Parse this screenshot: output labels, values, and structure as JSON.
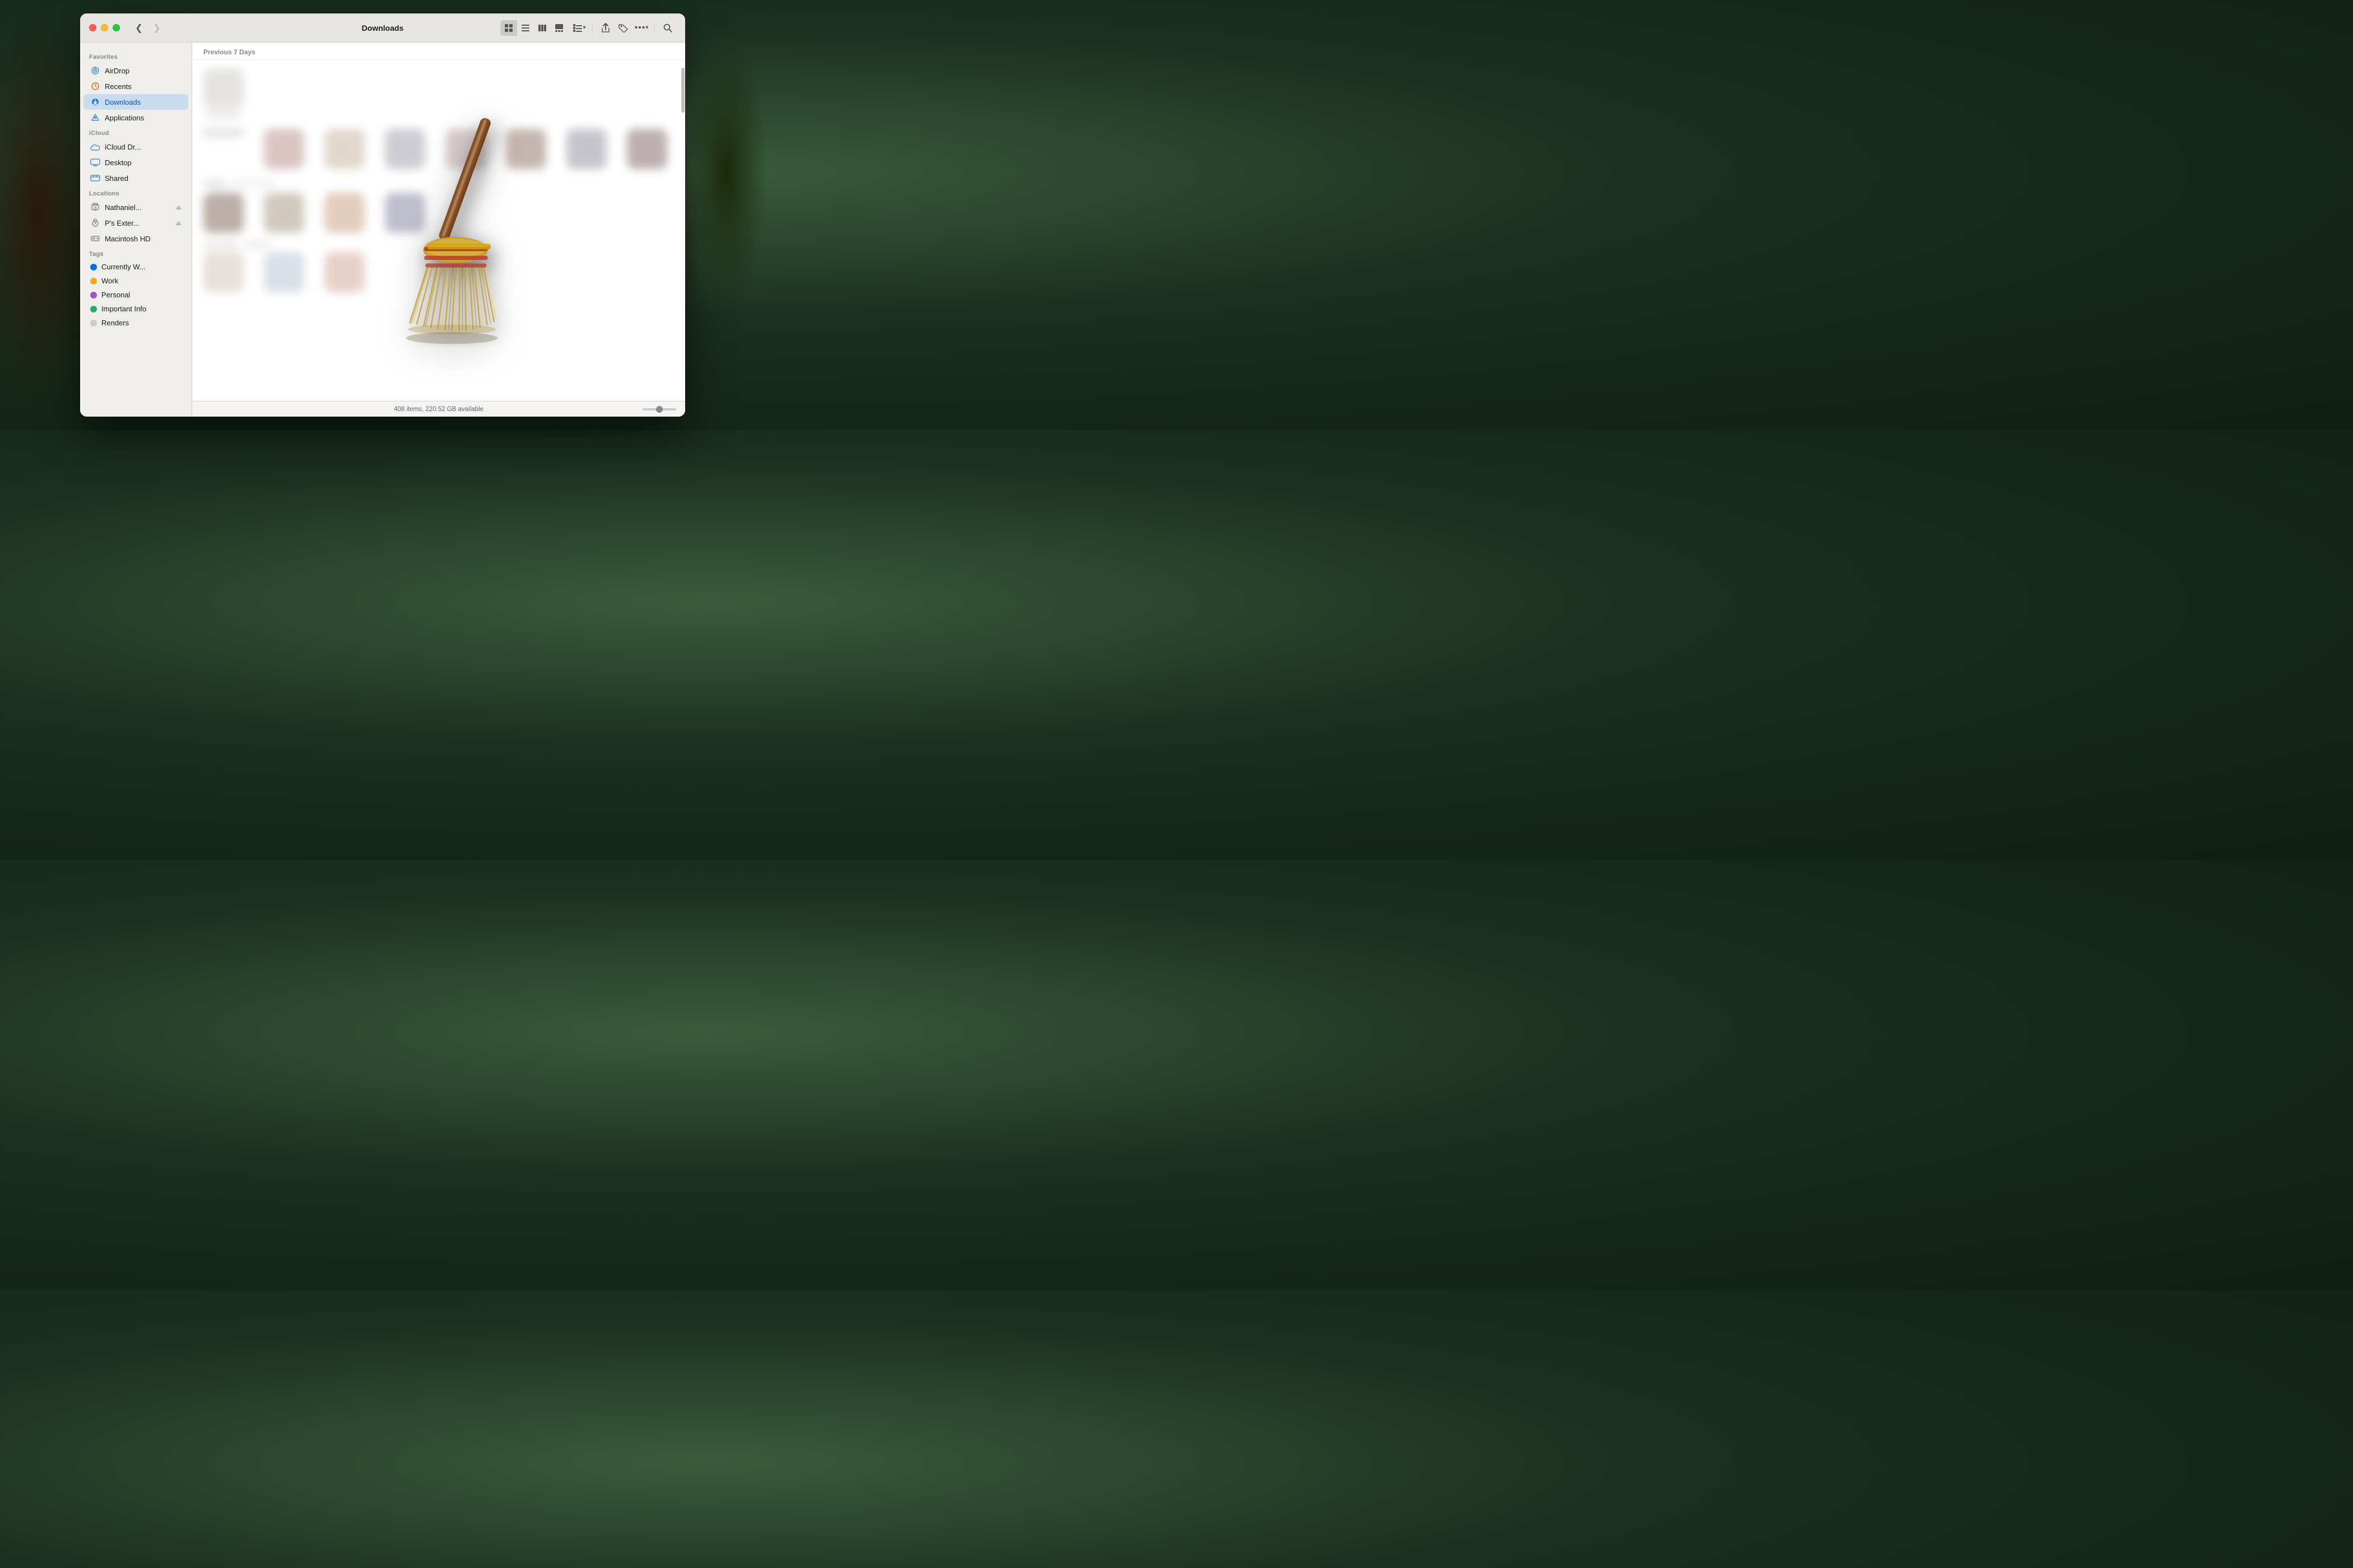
{
  "window": {
    "title": "Downloads"
  },
  "titlebar": {
    "back_disabled": false,
    "forward_disabled": true
  },
  "toolbar": {
    "view_grid_label": "⊞",
    "view_list_label": "☰",
    "view_column_label": "⏸",
    "view_gallery_label": "▬",
    "group_label": "⊞",
    "share_label": "↑",
    "tag_label": "🏷",
    "more_label": "•••",
    "search_label": "🔍"
  },
  "sidebar": {
    "favorites_label": "Favorites",
    "icloud_label": "iCloud",
    "locations_label": "Locations",
    "tags_label": "Tags",
    "items": [
      {
        "id": "airdrop",
        "label": "AirDrop",
        "icon": "airdrop"
      },
      {
        "id": "recents",
        "label": "Recents",
        "icon": "recents"
      },
      {
        "id": "downloads",
        "label": "Downloads",
        "icon": "downloads",
        "active": true
      },
      {
        "id": "applications",
        "label": "Applications",
        "icon": "applications"
      },
      {
        "id": "icloud-drive",
        "label": "iCloud Dr...",
        "icon": "icloud"
      },
      {
        "id": "desktop",
        "label": "Desktop",
        "icon": "desktop"
      },
      {
        "id": "shared",
        "label": "Shared",
        "icon": "shared"
      },
      {
        "id": "nathaniel",
        "label": "Nathaniel...",
        "icon": "disk",
        "eject": true
      },
      {
        "id": "ps-external",
        "label": "P's Exter...",
        "icon": "timedisk",
        "eject": true
      },
      {
        "id": "macintosh-hd",
        "label": "Macintosh HD",
        "icon": "harddisk"
      }
    ],
    "tags": [
      {
        "id": "currently-working",
        "label": "Currently W...",
        "color": "#0070f3"
      },
      {
        "id": "work",
        "label": "Work",
        "color": "#f5a623"
      },
      {
        "id": "personal",
        "label": "Personal",
        "color": "#9b59b6"
      },
      {
        "id": "important-info",
        "label": "Important Info",
        "color": "#27ae60"
      },
      {
        "id": "renders",
        "label": "Renders",
        "color": "#cccccc"
      }
    ]
  },
  "main": {
    "section_label": "Previous 7 Days",
    "status_text": "408 items, 220.52 GB available"
  }
}
